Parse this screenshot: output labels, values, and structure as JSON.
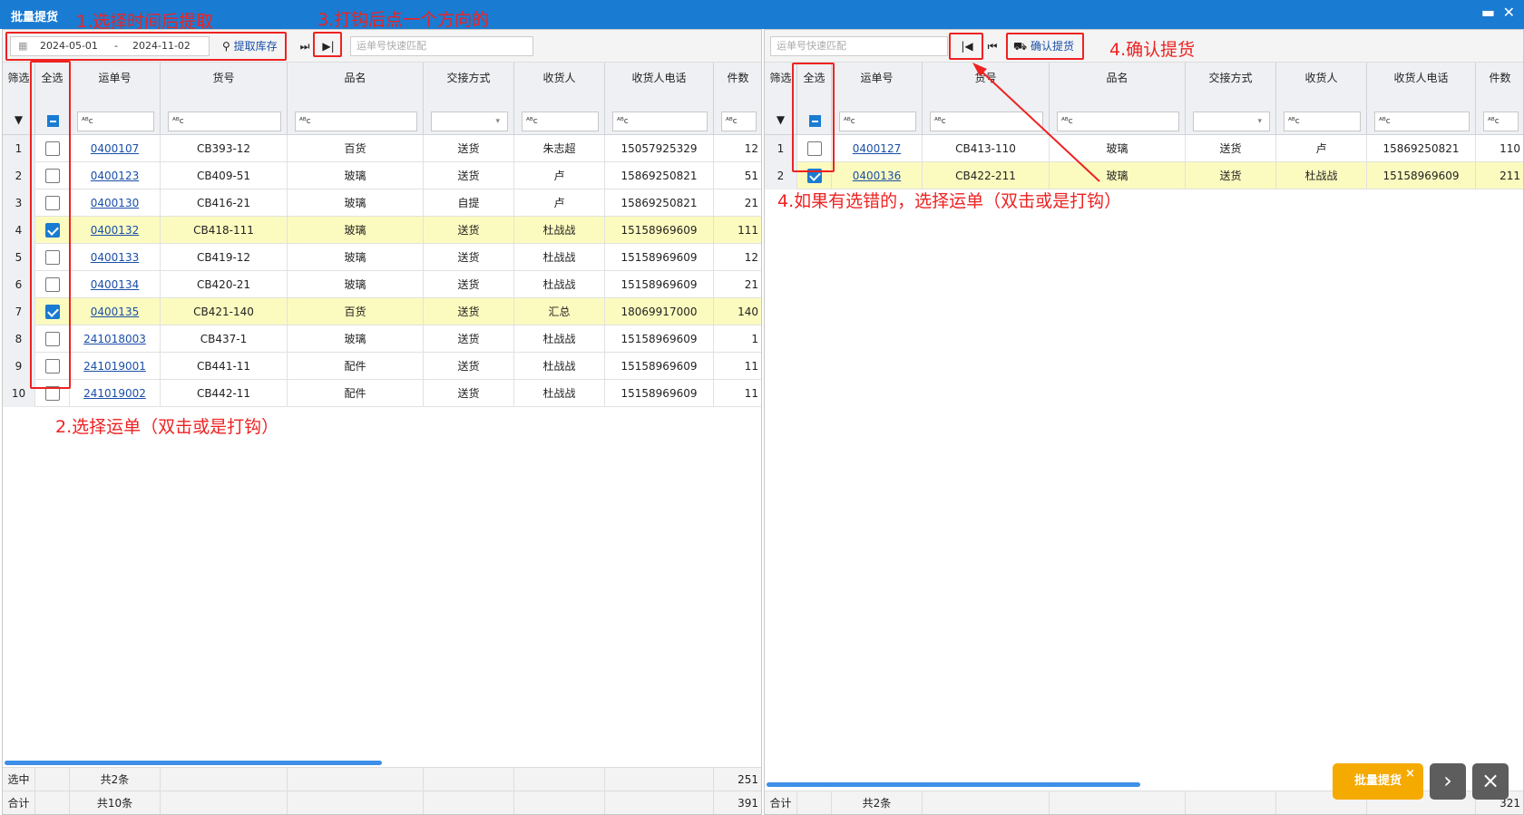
{
  "window": {
    "title": "批量提货",
    "min_icon": "minimize-icon",
    "close_icon": "close-icon"
  },
  "left": {
    "date_from": "2024-05-01",
    "date_sep": "-",
    "date_to": "2024-11-02",
    "fetch_btn": "提取库存",
    "search_placeholder": "运单号快速匹配",
    "headers": [
      "筛选",
      "全选",
      "运单号",
      "货号",
      "品名",
      "交接方式",
      "收货人",
      "收货人电话",
      "件数"
    ],
    "filter_tag": "ᴬᴮc",
    "rows": [
      {
        "n": "1",
        "checked": false,
        "way": "0400107",
        "goods": "CB393-12",
        "name": "百货",
        "mode": "送货",
        "rcv": "朱志超",
        "tel": "15057925329",
        "qty": "12"
      },
      {
        "n": "2",
        "checked": false,
        "way": "0400123",
        "goods": "CB409-51",
        "name": "玻璃",
        "mode": "送货",
        "rcv": "卢",
        "tel": "15869250821",
        "qty": "51"
      },
      {
        "n": "3",
        "checked": false,
        "way": "0400130",
        "goods": "CB416-21",
        "name": "玻璃",
        "mode": "自提",
        "rcv": "卢",
        "tel": "15869250821",
        "qty": "21"
      },
      {
        "n": "4",
        "checked": true,
        "way": "0400132",
        "goods": "CB418-111",
        "name": "玻璃",
        "mode": "送货",
        "rcv": "杜战战",
        "tel": "15158969609",
        "qty": "111"
      },
      {
        "n": "5",
        "checked": false,
        "way": "0400133",
        "goods": "CB419-12",
        "name": "玻璃",
        "mode": "送货",
        "rcv": "杜战战",
        "tel": "15158969609",
        "qty": "12"
      },
      {
        "n": "6",
        "checked": false,
        "way": "0400134",
        "goods": "CB420-21",
        "name": "玻璃",
        "mode": "送货",
        "rcv": "杜战战",
        "tel": "15158969609",
        "qty": "21"
      },
      {
        "n": "7",
        "checked": true,
        "way": "0400135",
        "goods": "CB421-140",
        "name": "百货",
        "mode": "送货",
        "rcv": "汇总",
        "tel": "18069917000",
        "qty": "140"
      },
      {
        "n": "8",
        "checked": false,
        "way": "241018003",
        "goods": "CB437-1",
        "name": "玻璃",
        "mode": "送货",
        "rcv": "杜战战",
        "tel": "15158969609",
        "qty": "1"
      },
      {
        "n": "9",
        "checked": false,
        "way": "241019001",
        "goods": "CB441-11",
        "name": "配件",
        "mode": "送货",
        "rcv": "杜战战",
        "tel": "15158969609",
        "qty": "11"
      },
      {
        "n": "10",
        "checked": false,
        "way": "241019002",
        "goods": "CB442-11",
        "name": "配件",
        "mode": "送货",
        "rcv": "杜战战",
        "tel": "15158969609",
        "qty": "11"
      }
    ],
    "footer": [
      {
        "label": "选中",
        "count": "共2条",
        "qty": "251"
      },
      {
        "label": "合计",
        "count": "共10条",
        "qty": "391"
      }
    ]
  },
  "right": {
    "search_placeholder": "运单号快速匹配",
    "confirm_btn": "确认提货",
    "headers": [
      "筛选",
      "全选",
      "运单号",
      "货号",
      "品名",
      "交接方式",
      "收货人",
      "收货人电话",
      "件数"
    ],
    "rows": [
      {
        "n": "1",
        "checked": false,
        "way": "0400127",
        "goods": "CB413-110",
        "name": "玻璃",
        "mode": "送货",
        "rcv": "卢",
        "tel": "15869250821",
        "qty": "110"
      },
      {
        "n": "2",
        "checked": true,
        "way": "0400136",
        "goods": "CB422-211",
        "name": "玻璃",
        "mode": "送货",
        "rcv": "杜战战",
        "tel": "15158969609",
        "qty": "211"
      }
    ],
    "footer": [
      {
        "label": "合计",
        "count": "共2条",
        "qty": "321"
      }
    ]
  },
  "annotations": {
    "a1": "1.选择时间后提取",
    "a2": "2.选择运单（双击或是打钩）",
    "a3": "3.打钩后点一个方向的",
    "a4": "4.确认提货",
    "a5": "4.如果有选错的，选择运单（双击或是打钩）"
  },
  "fab": {
    "main": "批量提货",
    "close_x": "×",
    "next": "›",
    "close": "×"
  },
  "colors": {
    "titlebar": "#1a7bd2",
    "highlight_row": "#fcfbbf",
    "annotation": "#ee2222",
    "fab": "#f5aa00"
  }
}
